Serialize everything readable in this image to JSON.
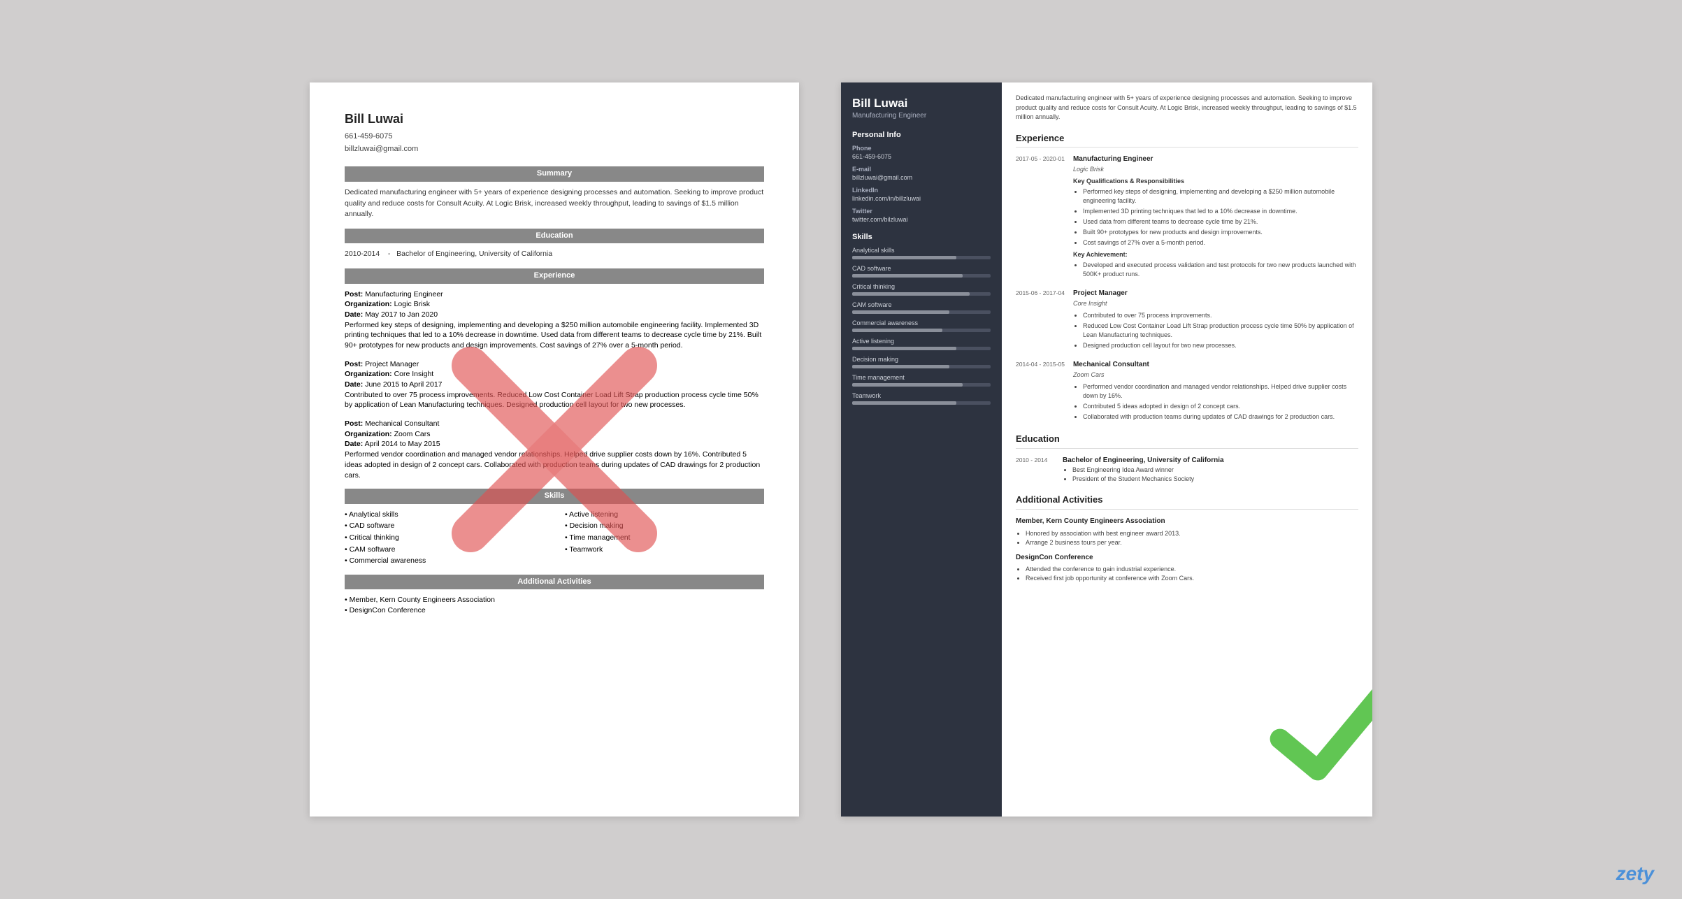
{
  "left_resume": {
    "name": "Bill Luwai",
    "phone": "661-459-6075",
    "email": "billzluwai@gmail.com",
    "sections": {
      "summary": {
        "label": "Summary",
        "text": "Dedicated manufacturing engineer with 5+ years of experience designing processes and automation. Seeking to improve product quality and reduce costs for Consult Acuity. At Logic Brisk, increased weekly throughput, leading to savings of $1.5 million annually."
      },
      "education": {
        "label": "Education",
        "entries": [
          {
            "dates": "2010-2014",
            "degree": "Bachelor of Engineering, University of California"
          }
        ]
      },
      "experience": {
        "label": "Experience",
        "jobs": [
          {
            "post_label": "Post:",
            "post": "Manufacturing Engineer",
            "org_label": "Organization:",
            "org": "Logic Brisk",
            "date_label": "Date:",
            "date": "May 2017 to Jan 2020",
            "description": "Performed key steps of designing, implementing and developing a $250 million automobile engineering facility. Implemented 3D printing techniques that led to a 10% decrease in downtime. Used data from different teams to decrease cycle time by 21%. Built 90+ prototypes for new products and design improvements. Cost savings of 27% over a 5-month period."
          },
          {
            "post_label": "Post:",
            "post": "Project Manager",
            "org_label": "Organization:",
            "org": "Core Insight",
            "date_label": "Date:",
            "date": "June 2015 to April 2017",
            "description": "Contributed to over 75 process improvements. Reduced Low Cost Container Load Lift Strap production process cycle time 50% by application of Lean Manufacturing techniques. Designed production cell layout for two new processes."
          },
          {
            "post_label": "Post:",
            "post": "Mechanical Consultant",
            "org_label": "Organization:",
            "org": "Zoom Cars",
            "date_label": "Date:",
            "date": "April 2014 to May 2015",
            "description": "Performed vendor coordination and managed vendor relationships. Helped drive supplier costs down by 16%. Contributed 5 ideas adopted in design of 2 concept cars. Collaborated with production teams during updates of CAD drawings for 2 production cars."
          }
        ]
      },
      "skills": {
        "label": "Skills",
        "list": [
          "Analytical skills",
          "CAD software",
          "Critical thinking",
          "CAM software",
          "Commercial awareness",
          "Active listening",
          "Decision making",
          "Time management",
          "Teamwork"
        ]
      },
      "additional": {
        "label": "Additional Activities",
        "list": [
          "Member, Kern County Engineers Association",
          "DesignCon Conference"
        ]
      }
    }
  },
  "right_resume": {
    "name": "Bill Luwai",
    "title": "Manufacturing Engineer",
    "summary": "Dedicated manufacturing engineer with 5+ years of experience designing processes and automation. Seeking to improve product quality and reduce costs for Consult Acuity. At Logic Brisk, increased weekly throughput, leading to savings of $1.5 million annually.",
    "sidebar": {
      "personal_info_label": "Personal Info",
      "phone_label": "Phone",
      "phone": "661-459-6075",
      "email_label": "E-mail",
      "email": "billzluwai@gmail.com",
      "linkedin_label": "LinkedIn",
      "linkedin": "linkedin.com/in/billzluwai",
      "twitter_label": "Twitter",
      "twitter": "twitter.com/bilzluwai",
      "skills_label": "Skills",
      "skills": [
        {
          "name": "Analytical skills",
          "pct": 75
        },
        {
          "name": "CAD software",
          "pct": 80
        },
        {
          "name": "Critical thinking",
          "pct": 85
        },
        {
          "name": "CAM software",
          "pct": 70
        },
        {
          "name": "Commercial awareness",
          "pct": 65
        },
        {
          "name": "Active listening",
          "pct": 75
        },
        {
          "name": "Decision making",
          "pct": 70
        },
        {
          "name": "Time management",
          "pct": 80
        },
        {
          "name": "Teamwork",
          "pct": 75
        }
      ]
    },
    "experience": {
      "label": "Experience",
      "jobs": [
        {
          "date": "2017-05 - 2020-01",
          "title": "Manufacturing Engineer",
          "company": "Logic Brisk",
          "key_qual_label": "Key Qualifications & Responsibilities",
          "bullets": [
            "Performed key steps of designing, implementing and developing a $250 million automobile engineering facility.",
            "Implemented 3D printing techniques that led to a 10% decrease in downtime.",
            "Used data from different teams to decrease cycle time by 21%.",
            "Built 90+ prototypes for new products and design improvements.",
            "Cost savings of 27% over a 5-month period."
          ],
          "achievement_label": "Key Achievement:",
          "achievement": "Developed and executed process validation and test protocols for two new products launched with 500K+ product runs."
        },
        {
          "date": "2015-06 - 2017-04",
          "title": "Project Manager",
          "company": "Core Insight",
          "bullets": [
            "Contributed to over 75 process improvements.",
            "Reduced Low Cost Container Load Lift Strap production process cycle time 50% by application of Lean Manufacturing techniques.",
            "Designed production cell layout for two new processes."
          ]
        },
        {
          "date": "2014-04 - 2015-05",
          "title": "Mechanical Consultant",
          "company": "Zoom Cars",
          "bullets": [
            "Performed vendor coordination and managed vendor relationships. Helped drive supplier costs down by 16%.",
            "Contributed 5 ideas adopted in design of 2 concept cars.",
            "Collaborated with production teams during updates of CAD drawings for 2 production cars."
          ]
        }
      ]
    },
    "education": {
      "label": "Education",
      "entries": [
        {
          "date": "2010 - 2014",
          "degree": "Bachelor of Engineering, University of California",
          "bullets": [
            "Best Engineering Idea Award winner",
            "President of the Student Mechanics Society"
          ]
        }
      ]
    },
    "additional": {
      "label": "Additional Activities",
      "entries": [
        {
          "title": "Member, Kern County Engineers Association",
          "bullets": [
            "Honored by association with best engineer award 2013.",
            "Arrange 2 business tours per year."
          ]
        },
        {
          "title": "DesignCon Conference",
          "bullets": [
            "Attended the conference to gain industrial experience.",
            "Received first job opportunity at conference with Zoom Cars."
          ]
        }
      ]
    }
  },
  "branding": {
    "zety": "zety"
  }
}
